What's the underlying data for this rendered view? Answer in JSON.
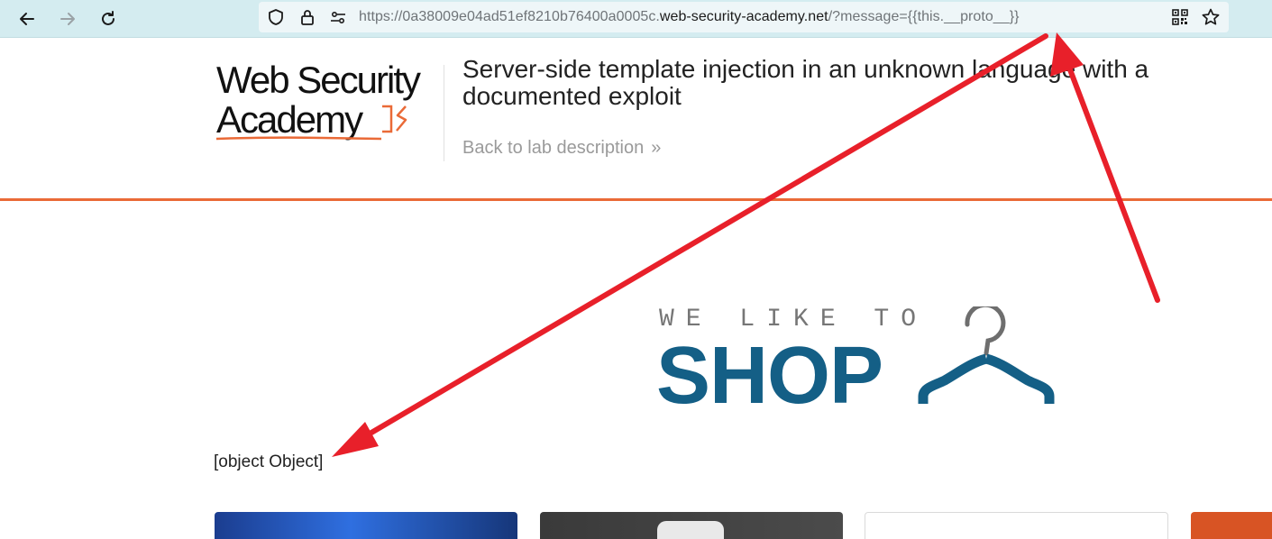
{
  "browser": {
    "url_prefix": "https://0a38009e04ad51ef8210b76400a0005c.",
    "url_host": "web-security-academy.net",
    "url_suffix": "/?message={{this.__proto__}}",
    "icons": [
      "back-icon",
      "forward-icon",
      "reload-icon",
      "shield-icon",
      "lock-icon",
      "permissions-icon",
      "qr-code-icon",
      "bookmark-star-icon"
    ]
  },
  "header": {
    "logo_line1": "Web Security",
    "logo_line2": "Academy",
    "lab_title": "Server-side template injection in an unknown language with a documented exploit",
    "back_link": "Back to lab description",
    "back_chevron": "»"
  },
  "banner": {
    "tagline": "WE LIKE TO",
    "headline": "SHOP"
  },
  "content": {
    "message": "[object Object]"
  },
  "colors": {
    "accent_orange": "#ea6a37",
    "shop_blue": "#145f86",
    "annotation_red": "#e8202a"
  }
}
